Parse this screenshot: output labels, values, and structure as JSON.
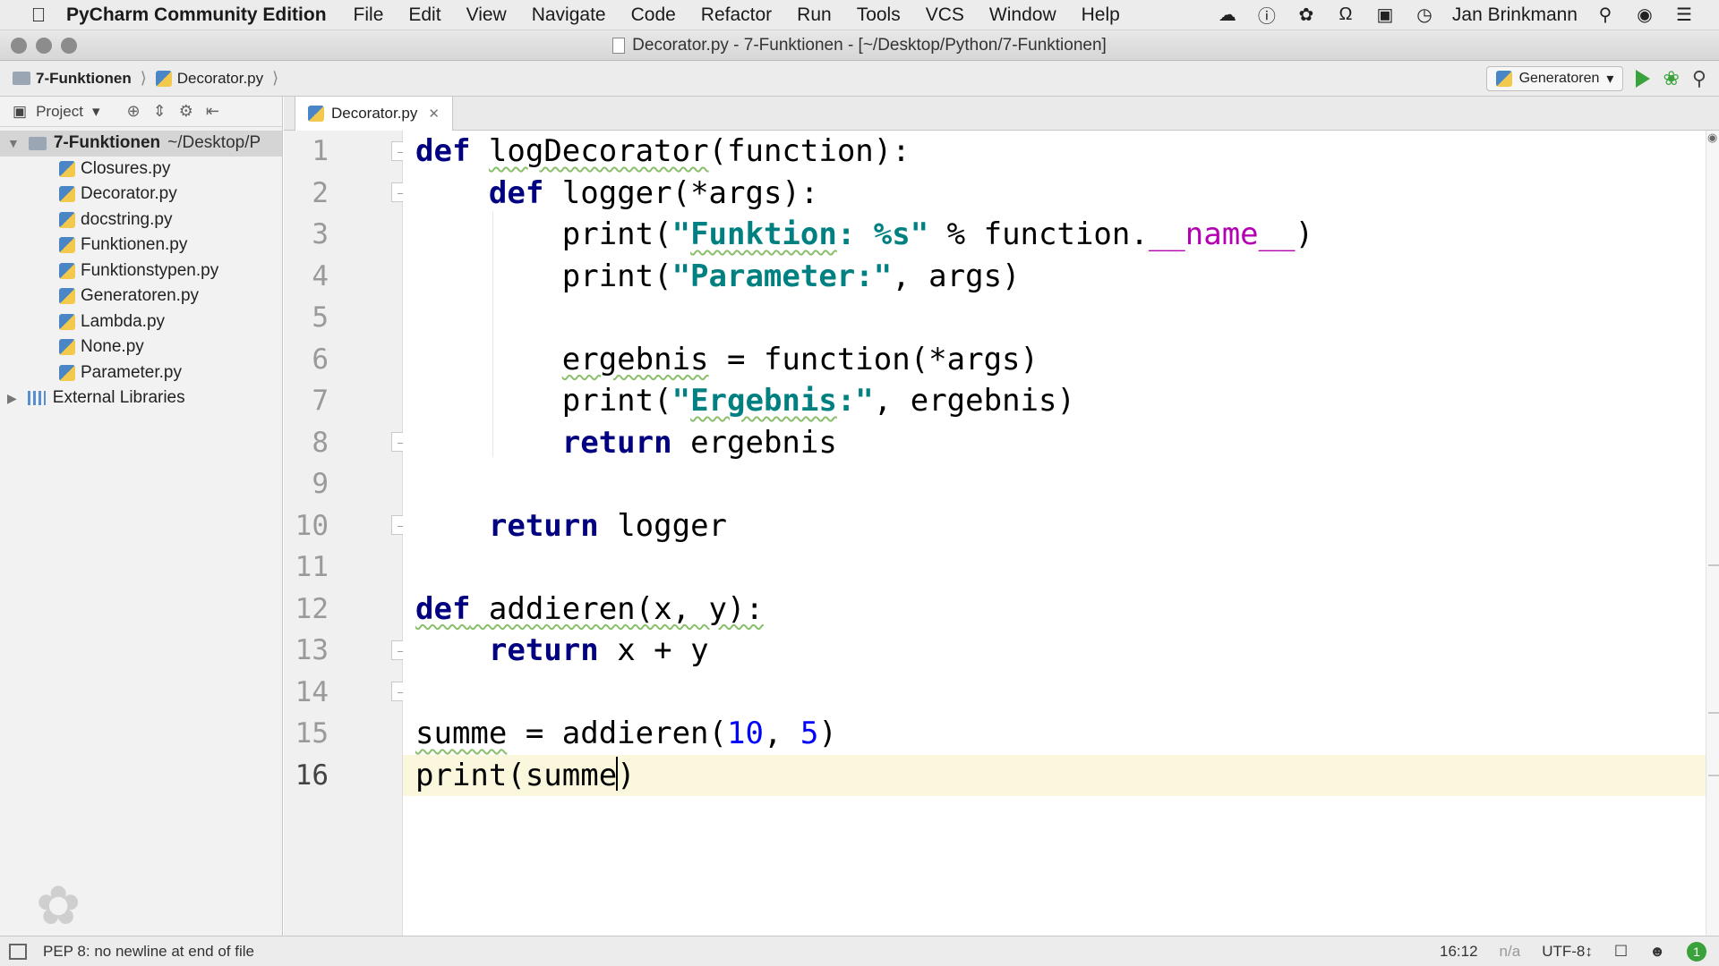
{
  "menubar": {
    "app_name": "PyCharm Community Edition",
    "items": [
      "File",
      "Edit",
      "View",
      "Navigate",
      "Code",
      "Refactor",
      "Run",
      "Tools",
      "VCS",
      "Window",
      "Help"
    ],
    "user": "Jan Brinkmann"
  },
  "window": {
    "title": "Decorator.py - 7-Funktionen - [~/Desktop/Python/7-Funktionen]"
  },
  "breadcrumb": {
    "project": "7-Funktionen",
    "file": "Decorator.py"
  },
  "run_config": {
    "label": "Generatoren"
  },
  "project_panel": {
    "header": "Project",
    "root_name": "7-Funktionen",
    "root_path": "~/Desktop/P",
    "files": [
      "Closures.py",
      "Decorator.py",
      "docstring.py",
      "Funktionen.py",
      "Funktionstypen.py",
      "Generatoren.py",
      "Lambda.py",
      "None.py",
      "Parameter.py"
    ],
    "external": "External Libraries"
  },
  "editor": {
    "tab_label": "Decorator.py",
    "line_numbers": [
      "1",
      "2",
      "3",
      "4",
      "5",
      "6",
      "7",
      "8",
      "9",
      "10",
      "11",
      "12",
      "13",
      "14",
      "15",
      "16"
    ],
    "current_line": 16
  },
  "statusbar": {
    "message": "PEP 8: no newline at end of file",
    "position": "16:12",
    "na": "n/a",
    "encoding": "UTF-8↕",
    "badge": "1"
  },
  "colors": {
    "keyword": "#000080",
    "string": "#008080",
    "number": "#0000ff",
    "magic": "#b200b2",
    "current_line_bg": "#fbf7dc"
  }
}
